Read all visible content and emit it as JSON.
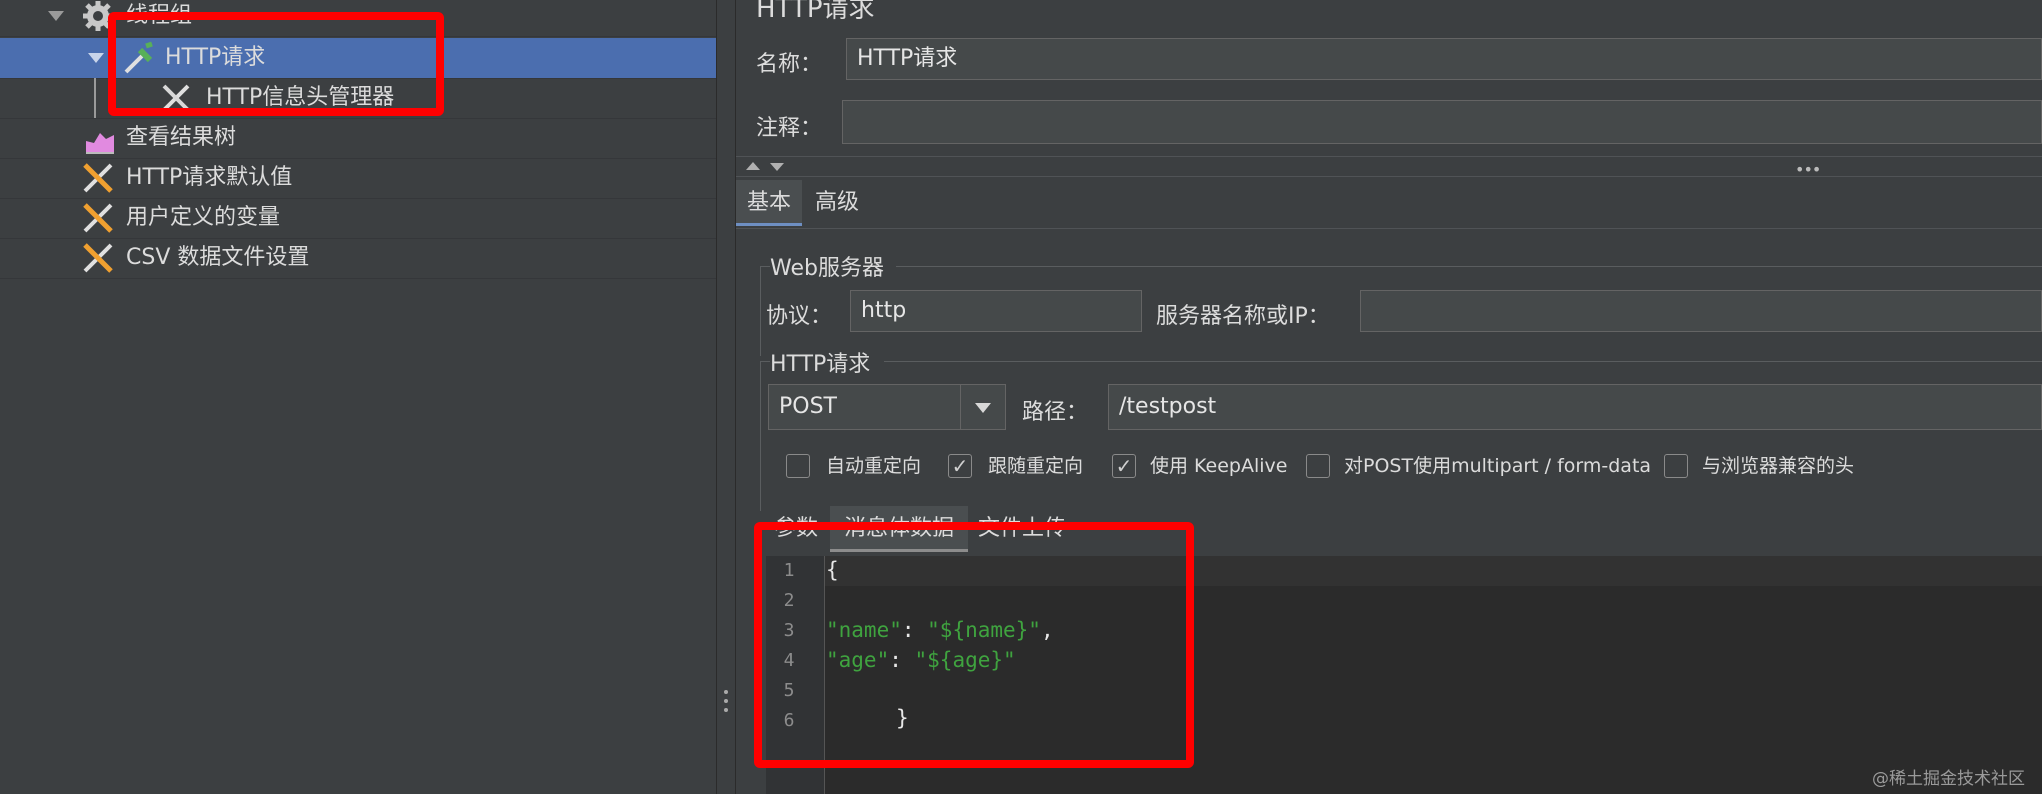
{
  "tree": {
    "items": [
      {
        "label": "线程组"
      },
      {
        "label": "HTTP请求"
      },
      {
        "label": "HTTP信息头管理器"
      },
      {
        "label": "查看结果树"
      },
      {
        "label": "HTTP请求默认值"
      },
      {
        "label": "用户定义的变量"
      },
      {
        "label": "CSV 数据文件设置"
      }
    ]
  },
  "panel": {
    "header_title": "HTTP请求",
    "name_label": "名称：",
    "name_value": "HTTP请求",
    "comment_label": "注释：",
    "comment_value": "",
    "tabs": [
      {
        "label": "基本"
      },
      {
        "label": "高级"
      }
    ],
    "web_server_title": "Web服务器",
    "protocol_label": "协议：",
    "protocol_value": "http",
    "server_label": "服务器名称或IP：",
    "server_value": "",
    "http_request_title": "HTTP请求",
    "method_value": "POST",
    "path_label": "路径：",
    "path_value": "/testpost",
    "checkboxes": [
      {
        "label": "自动重定向",
        "checked": false
      },
      {
        "label": "跟随重定向",
        "checked": true
      },
      {
        "label": "使用 KeepAlive",
        "checked": true
      },
      {
        "label": "对POST使用multipart / form-data",
        "checked": false
      },
      {
        "label": "与浏览器兼容的头",
        "checked": false
      }
    ],
    "sub_tabs": [
      {
        "label": "参数"
      },
      {
        "label": "消息体数据"
      },
      {
        "label": "文件上传"
      }
    ],
    "check_mark": "✓"
  },
  "editor": {
    "line_numbers": [
      "1",
      "2",
      "3",
      "4",
      "5",
      "6"
    ],
    "line1": "{",
    "line3_key": "\"name\"",
    "line3_colon": ": ",
    "line3_value": "\"${name}\"",
    "line3_comma": ",",
    "line4_key": "\"age\"",
    "line4_colon": ": ",
    "line4_value": "\"${age}\"",
    "line6": "}"
  },
  "watermark": "@稀土掘金技术社区",
  "colors": {
    "selection": "#4b6eaf",
    "highlight_box": "#ff0000",
    "json_string": "#3fa33f"
  }
}
